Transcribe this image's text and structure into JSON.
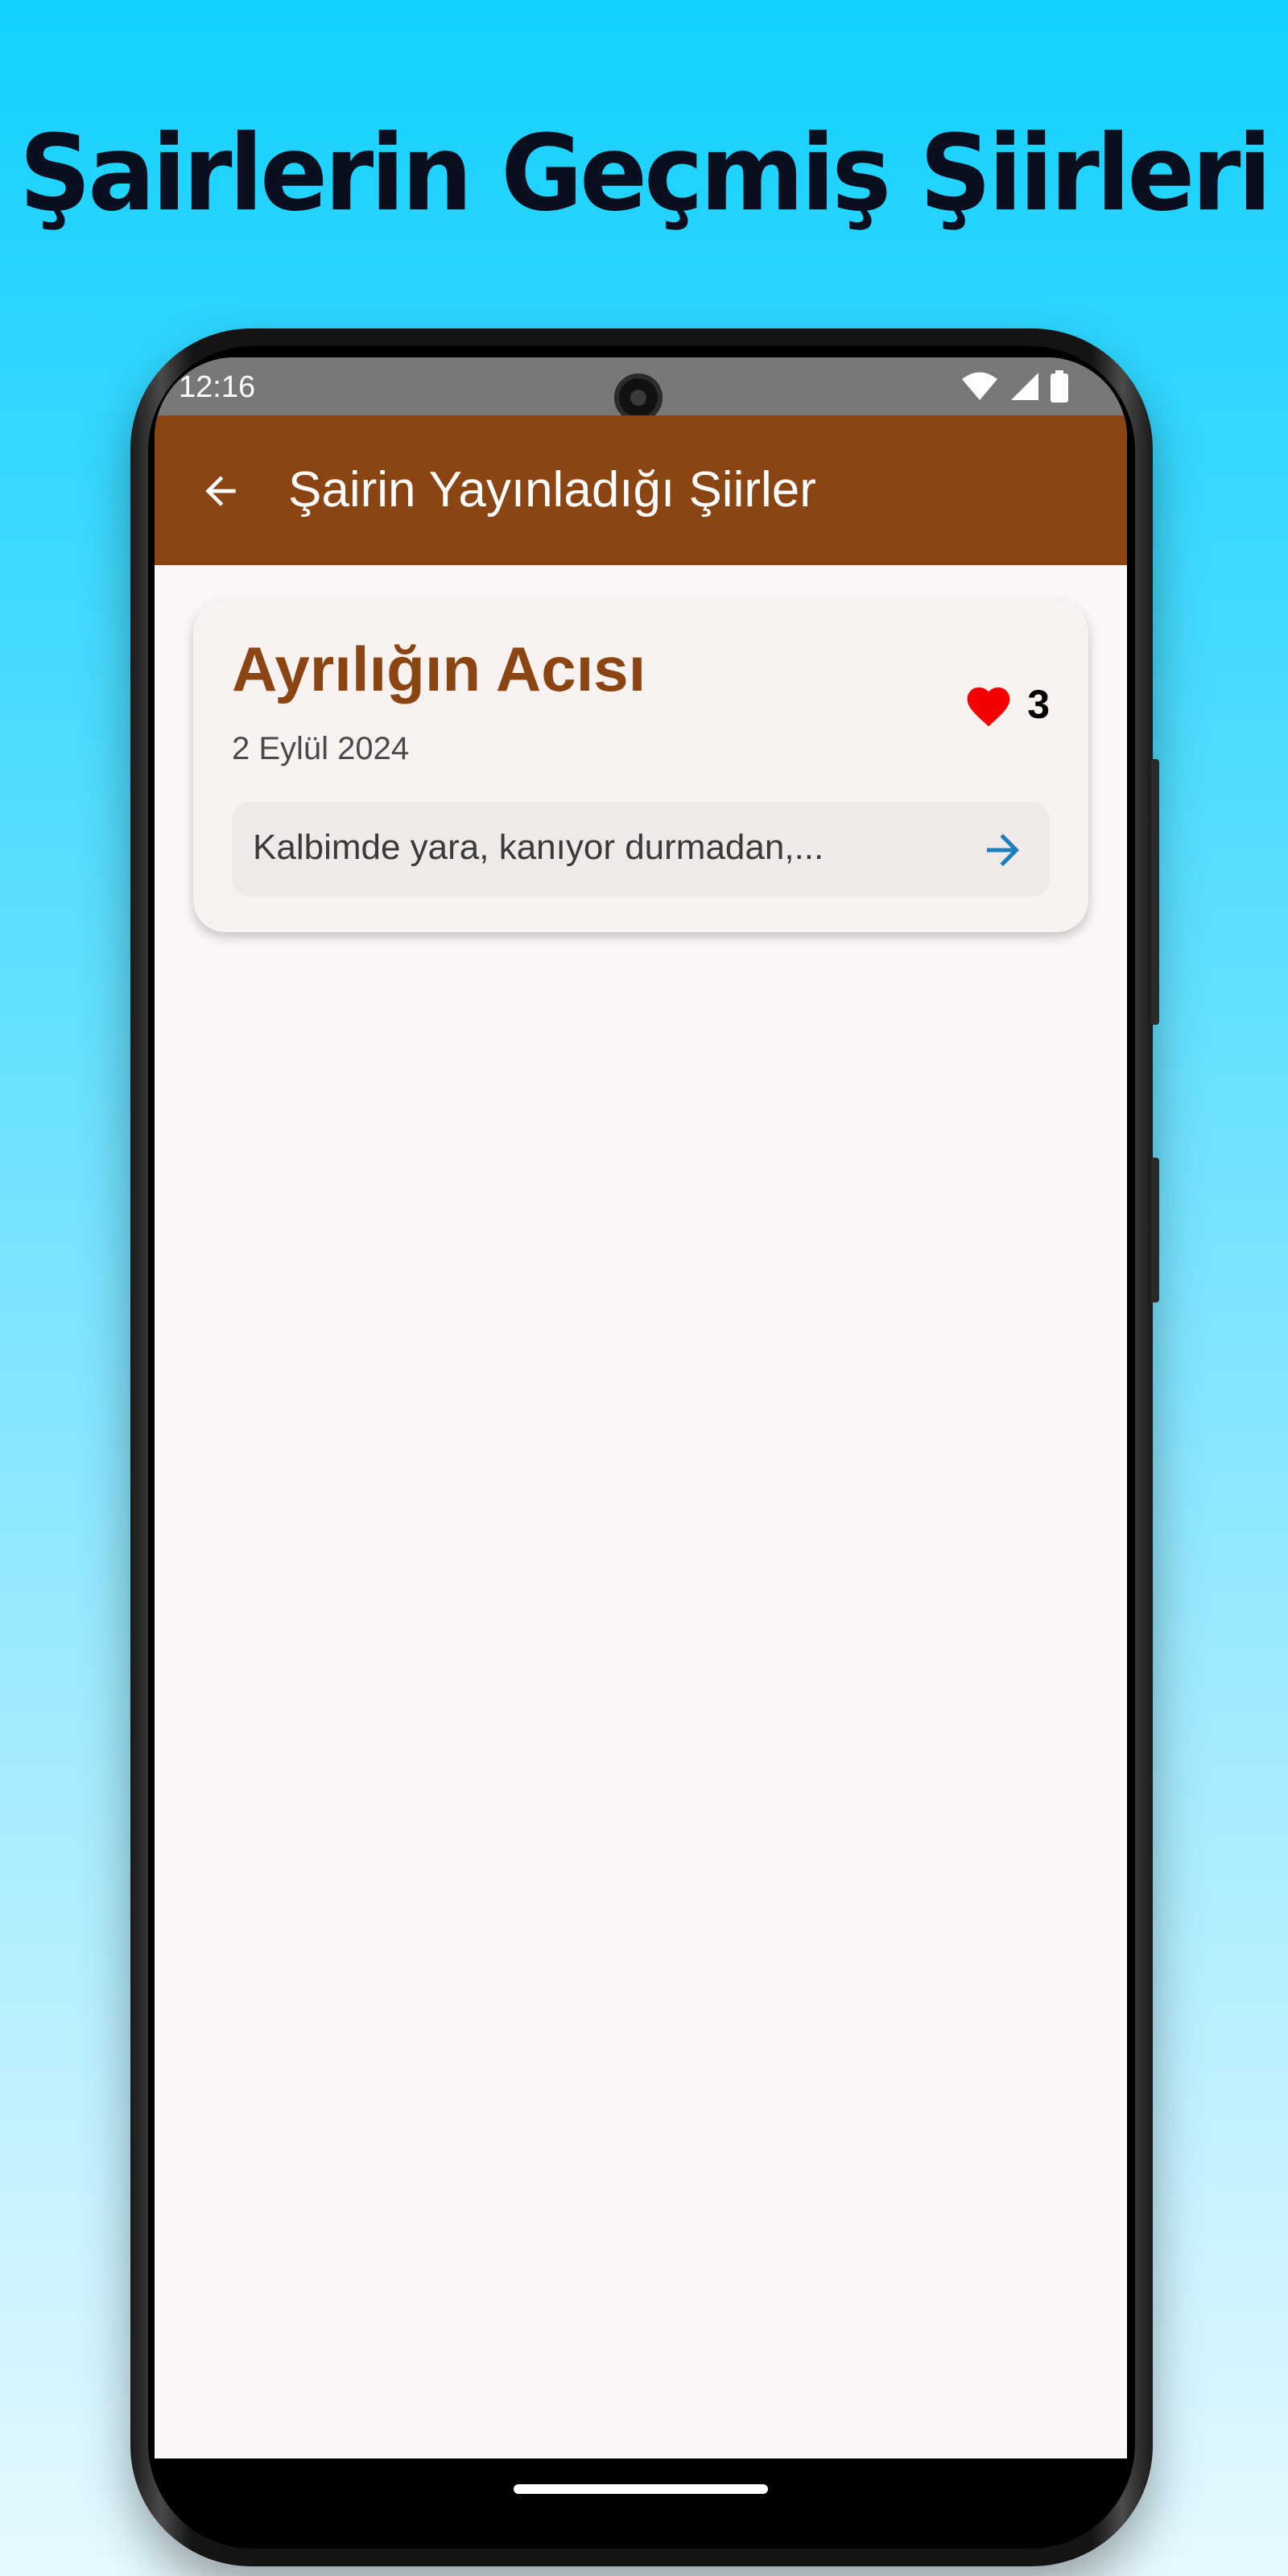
{
  "promo": {
    "title": "Şairlerin Geçmiş Şiirleri"
  },
  "status_bar": {
    "time": "12:16",
    "icons": [
      "wifi-icon",
      "signal-icon",
      "battery-icon"
    ]
  },
  "app_bar": {
    "title": "Şairin Yayınladığı Şiirler",
    "back_icon": "arrow-back-icon"
  },
  "poems": [
    {
      "title": "Ayrılığın Acısı",
      "date": "2 Eylül 2024",
      "likes": "3",
      "excerpt": "Kalbimde yara, kanıyor durmadan,..."
    }
  ],
  "colors": {
    "app_bar": "#8b4513",
    "card_title": "#8b4513",
    "heart": "#f40000",
    "arrow": "#1a7fc1",
    "background": "#fbf7f6"
  }
}
